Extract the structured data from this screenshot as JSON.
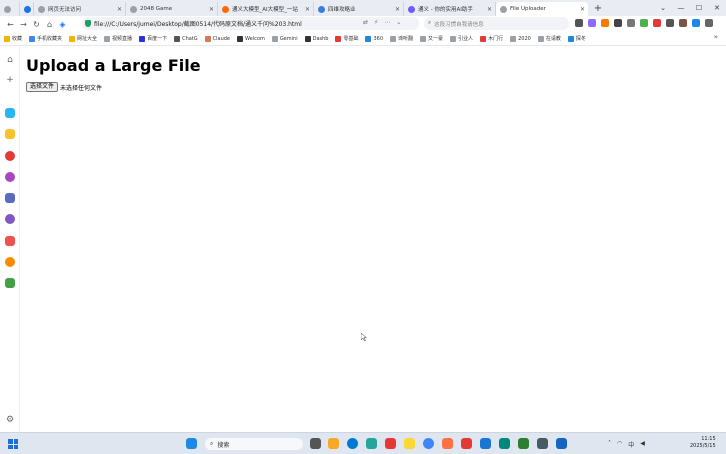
{
  "browser": {
    "tabs": [
      {
        "label": "网页无法访问",
        "color": "#9aa0a6"
      },
      {
        "label": "2048 Game",
        "color": "#9aa0a6"
      },
      {
        "label": "通义大模型_AI大模型_一站",
        "color": "#ff6a00"
      },
      {
        "label": "四维攻略业",
        "color": "#3b7ddd"
      },
      {
        "label": "通义 - 你的实用AI助手",
        "color": "#6a5cff"
      },
      {
        "label": "File Uploader",
        "color": "#9aa0a6"
      }
    ],
    "new_tab_label": "+",
    "address": "file:///C:/Users/jumei/Desktop/截图0514/代码原文档/通义千问%203.html",
    "search_placeholder": "这段习惯自我请信息",
    "bookmarks": [
      {
        "label": "收藏",
        "color": "#f4b400"
      },
      {
        "label": "手机收藏夹",
        "color": "#4285f4"
      },
      {
        "label": "网址大全",
        "color": "#f4b400"
      },
      {
        "label": "视频直播",
        "color": "#9aa0a6"
      },
      {
        "label": "百度一下",
        "color": "#2932e1"
      },
      {
        "label": "ChatG",
        "color": "#555555"
      },
      {
        "label": "Claude",
        "color": "#d97757"
      },
      {
        "label": "Welcom",
        "color": "#333333"
      },
      {
        "label": "Gemini",
        "color": "#9aa0a6"
      },
      {
        "label": "Dashb",
        "color": "#333333"
      },
      {
        "label": "零基础",
        "color": "#e53935"
      },
      {
        "label": "360",
        "color": "#1e88e5"
      },
      {
        "label": "谛听翻",
        "color": "#9aa0a6"
      },
      {
        "label": "又一豪",
        "color": "#9aa0a6"
      },
      {
        "label": "引业人",
        "color": "#9aa0a6"
      },
      {
        "label": "木门行",
        "color": "#e53935"
      },
      {
        "label": "2020",
        "color": "#9aa0a6"
      },
      {
        "label": "在请教",
        "color": "#9aa0a6"
      },
      {
        "label": "探冬",
        "color": "#1e88e5"
      }
    ],
    "bookmarks_more": "»"
  },
  "page": {
    "title": "Upload a Large File",
    "choose_file_label": "选择文件",
    "no_file_text": "未选择任何文件"
  },
  "taskbar": {
    "search_label": "搜索",
    "clock_time": "11:15",
    "clock_date": "2025/5/15",
    "lang": "中"
  }
}
